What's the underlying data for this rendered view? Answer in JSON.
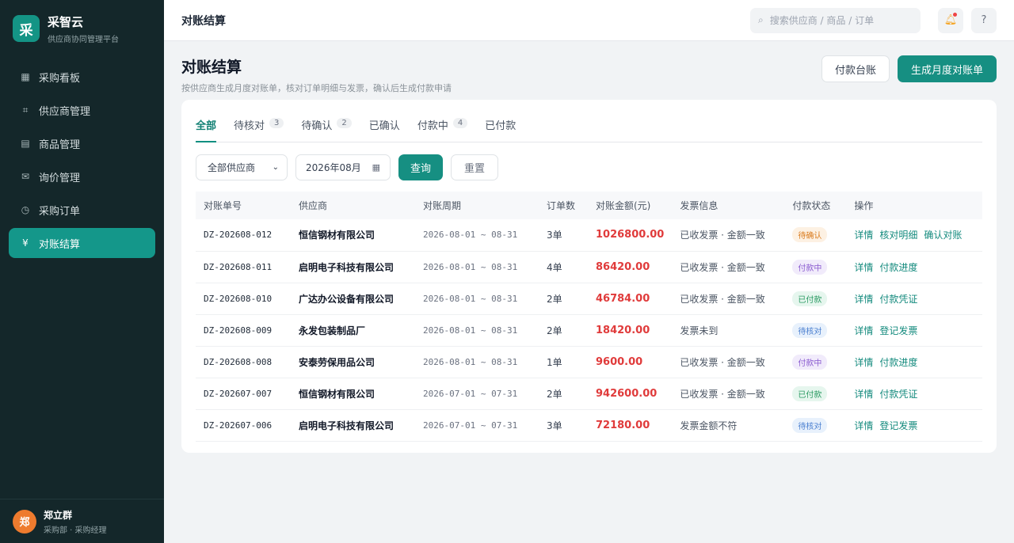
{
  "brand": {
    "logo_char": "采",
    "name": "采智云",
    "subtitle": "供应商协同管理平台"
  },
  "nav": [
    {
      "label": "采购看板",
      "icon": "grid-icon",
      "glyph": "▦",
      "active": false
    },
    {
      "label": "供应商管理",
      "icon": "hash-icon",
      "glyph": "⌗",
      "active": false
    },
    {
      "label": "商品管理",
      "icon": "list-icon",
      "glyph": "▤",
      "active": false
    },
    {
      "label": "询价管理",
      "icon": "mail-icon",
      "glyph": "✉",
      "active": false
    },
    {
      "label": "采购订单",
      "icon": "clock-icon",
      "glyph": "◷",
      "active": false
    },
    {
      "label": "对账结算",
      "icon": "yen-icon",
      "glyph": "¥",
      "active": true
    }
  ],
  "user": {
    "avatar_char": "郑",
    "name": "郑立群",
    "role": "采购部 · 采购经理"
  },
  "topbar": {
    "title": "对账结算",
    "search_placeholder": "搜索供应商 / 商品 / 订单",
    "help": "?"
  },
  "page": {
    "title": "对账结算",
    "description": "按供应商生成月度对账单，核对订单明细与发票，确认后生成付款申请",
    "btn_ledger": "付款台账",
    "btn_generate": "生成月度对账单"
  },
  "tabs": [
    {
      "label": "全部",
      "count": "",
      "active": true
    },
    {
      "label": "待核对",
      "count": "3",
      "active": false
    },
    {
      "label": "待确认",
      "count": "2",
      "active": false
    },
    {
      "label": "已确认",
      "count": "",
      "active": false
    },
    {
      "label": "付款中",
      "count": "4",
      "active": false
    },
    {
      "label": "已付款",
      "count": "",
      "active": false
    }
  ],
  "filters": {
    "supplier": "全部供应商",
    "month": "2026年08月",
    "query": "查询",
    "reset": "重置"
  },
  "table": {
    "headers": [
      "对账单号",
      "供应商",
      "对账周期",
      "订单数",
      "对账金额(元)",
      "发票信息",
      "付款状态",
      "操作"
    ],
    "rows": [
      {
        "id": "DZ-202608-012",
        "supplier": "恒信钢材有限公司",
        "period": "2026-08-01 ~ 08-31",
        "orders": "3单",
        "amount": "1026800.00",
        "invoice": "已收发票 · 金额一致",
        "status": "待确认",
        "status_kind": "pending-confirm",
        "actions": [
          "详情",
          "核对明细",
          "确认对账"
        ]
      },
      {
        "id": "DZ-202608-011",
        "supplier": "启明电子科技有限公司",
        "period": "2026-08-01 ~ 08-31",
        "orders": "4单",
        "amount": "86420.00",
        "invoice": "已收发票 · 金额一致",
        "status": "付款中",
        "status_kind": "paying",
        "actions": [
          "详情",
          "付款进度"
        ]
      },
      {
        "id": "DZ-202608-010",
        "supplier": "广达办公设备有限公司",
        "period": "2026-08-01 ~ 08-31",
        "orders": "2单",
        "amount": "46784.00",
        "invoice": "已收发票 · 金额一致",
        "status": "已付款",
        "status_kind": "paid",
        "actions": [
          "详情",
          "付款凭证"
        ]
      },
      {
        "id": "DZ-202608-009",
        "supplier": "永发包装制品厂",
        "period": "2026-08-01 ~ 08-31",
        "orders": "2单",
        "amount": "18420.00",
        "invoice": "发票未到",
        "status": "待核对",
        "status_kind": "pending-check",
        "actions": [
          "详情",
          "登记发票"
        ]
      },
      {
        "id": "DZ-202608-008",
        "supplier": "安泰劳保用品公司",
        "period": "2026-08-01 ~ 08-31",
        "orders": "1单",
        "amount": "9600.00",
        "invoice": "已收发票 · 金额一致",
        "status": "付款中",
        "status_kind": "paying",
        "actions": [
          "详情",
          "付款进度"
        ]
      },
      {
        "id": "DZ-202607-007",
        "supplier": "恒信钢材有限公司",
        "period": "2026-07-01 ~ 07-31",
        "orders": "2单",
        "amount": "942600.00",
        "invoice": "已收发票 · 金额一致",
        "status": "已付款",
        "status_kind": "paid",
        "actions": [
          "详情",
          "付款凭证"
        ]
      },
      {
        "id": "DZ-202607-006",
        "supplier": "启明电子科技有限公司",
        "period": "2026-07-01 ~ 07-31",
        "orders": "3单",
        "amount": "72180.00",
        "invoice": "发票金额不符",
        "status": "待核对",
        "status_kind": "pending-check",
        "actions": [
          "详情",
          "登记发票"
        ]
      }
    ]
  },
  "status_colors": {
    "pending-confirm": {
      "bg": "#fdf1e3",
      "fg": "#d97a1c"
    },
    "paying": {
      "bg": "#f1ebfb",
      "fg": "#8a5bd0"
    },
    "paid": {
      "bg": "#e6f6ee",
      "fg": "#2a9a62"
    },
    "pending-check": {
      "bg": "#e8f1fc",
      "fg": "#4a7fd0"
    }
  },
  "colors": {
    "accent": "#168f82",
    "sidebar": "#14272a",
    "amount": "#e03b3b"
  }
}
